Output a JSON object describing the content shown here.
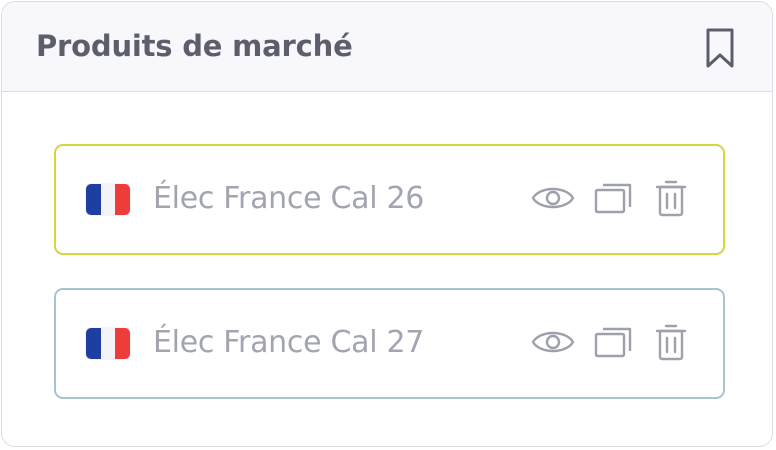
{
  "panel": {
    "title": "Produits de marché",
    "bookmark_icon": "bookmark-icon"
  },
  "items": [
    {
      "label": "Élec France Cal 26",
      "flag": "france-flag-icon",
      "border_color": "#d4d63a",
      "actions": [
        "eye-icon",
        "copy-icon",
        "trash-icon"
      ]
    },
    {
      "label": "Élec France Cal 27",
      "flag": "france-flag-icon",
      "border_color": "#a8c2cf",
      "actions": [
        "eye-icon",
        "copy-icon",
        "trash-icon"
      ]
    }
  ],
  "colors": {
    "title_text": "#5c5f6b",
    "item_text": "#a2a5b0",
    "icon_stroke": "#9ea1ad",
    "header_bg": "#f8f8fc",
    "border": "#dcdce3"
  }
}
